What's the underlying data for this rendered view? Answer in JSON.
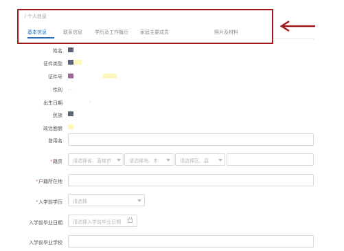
{
  "breadcrumb": {
    "text": "/ 个人信息"
  },
  "tabs": [
    {
      "label": "基本信息"
    },
    {
      "label": "联系信息"
    },
    {
      "label": "学历及工作履历"
    },
    {
      "label": "家庭主要成员"
    },
    {
      "label": "照片及材料"
    }
  ],
  "colors": {
    "accent": "#1f6fbf",
    "annotation_red": "#a31818",
    "required": "#e0502a",
    "masked_dark": "#5d6474",
    "masked_purple": "#9a6a96",
    "masked_yellow": "#fff7b8"
  },
  "info": {
    "name_label": "姓名",
    "idtype_label": "证件类型",
    "idnum_label": "证件号",
    "gender_label": "性别",
    "gender_value": ".  .",
    "birth_label": "出生日期",
    "birth_value": ".",
    "ethnic_label": "民族",
    "political_label": "政治面貌"
  },
  "form": {
    "used_name_label": "曾用名",
    "native_label": "籍贯",
    "native_province_placeholder": "请选择省、直辖市",
    "native_city_placeholder": "请选择地、市",
    "native_district_placeholder": "请选择区、县",
    "hukou_label": "户籍所在地",
    "edu_label": "入学前学历",
    "edu_placeholder": "请选择",
    "grad_date_label": "入学前毕业日期",
    "grad_date_placeholder": "请选择入学前毕业日期",
    "grad_school_label": "入学前毕业学校"
  },
  "icons": {
    "arrow": "left-arrow-icon",
    "caret": "chevron-down-icon",
    "calendar": "calendar-icon"
  }
}
